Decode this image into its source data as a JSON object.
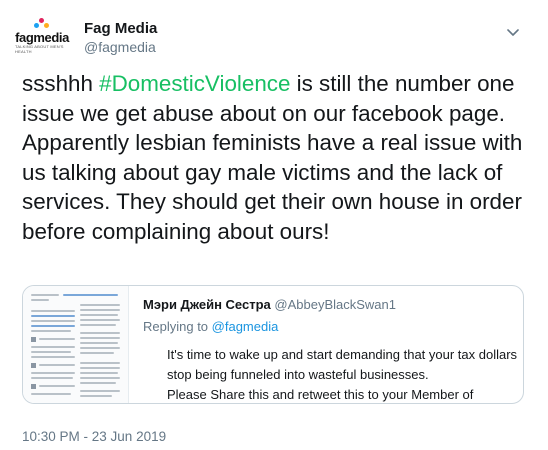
{
  "tweet": {
    "author": {
      "display_name": "Fag Media",
      "handle": "@fagmedia",
      "avatar_word": "fagmedia",
      "avatar_tagline": "TALKING ABOUT MEN'S HEALTH"
    },
    "text_before": "ssshhh ",
    "hashtag": "#DomesticViolence",
    "text_after": " is still the number one issue we get abuse about on our facebook page. Apparently lesbian feminists have a real issue with us talking about gay male victims and the lack of services. They should get their own house in order before complaining about ours!",
    "timestamp": "10:30 PM - 23 Jun 2019"
  },
  "quoted": {
    "display_name": "Мэри Джейн Сестра",
    "handle": "@AbbeyBlackSwan1",
    "reply_prefix": "Replying to ",
    "reply_handle": "@fagmedia",
    "text_line1": "It's time to wake up and start demanding that your tax dollars stop being funneled into wasteful businesses.",
    "text_line2": "Please Share this and retweet this to your Member of Parliament."
  },
  "colors": {
    "hashtag": "#17bf63",
    "link": "#1b95e0",
    "muted": "#657786",
    "border": "#ccd6dd",
    "logo_dots": [
      "#1da1f2",
      "#e0245e",
      "#ffad1f"
    ]
  },
  "icons": {
    "more": "chevron-down-icon"
  }
}
